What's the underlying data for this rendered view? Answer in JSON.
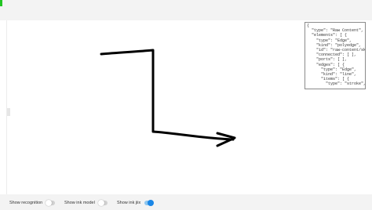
{
  "canvas": {
    "json_lines": [
      "{",
      "  \"type\": \"Raw Content\",",
      "  \"elements\": [ {",
      "    \"type\": \"Edge\",",
      "    \"kind\": \"polyedge\",",
      "    \"id\": \"raw-content/ske",
      "    \"connected\": [ ],",
      "    \"ports\": [ ],",
      "    \"edges\": [ {",
      "      \"type\": \"Edge\",",
      "      \"kind\": \"line\",",
      "      \"items\": [ {",
      "        \"type\": \"stroke\","
    ]
  },
  "toolbar": {
    "show_recognition": {
      "label": "Show recognition",
      "on": false
    },
    "show_ink_model": {
      "label": "Show ink model",
      "on": false
    },
    "show_ink_jiix": {
      "label": "Show ink jiix",
      "on": true
    }
  },
  "colors": {
    "toggle_on": "#1a86e6",
    "stroke": "#000000",
    "indicator": "#22c522"
  }
}
